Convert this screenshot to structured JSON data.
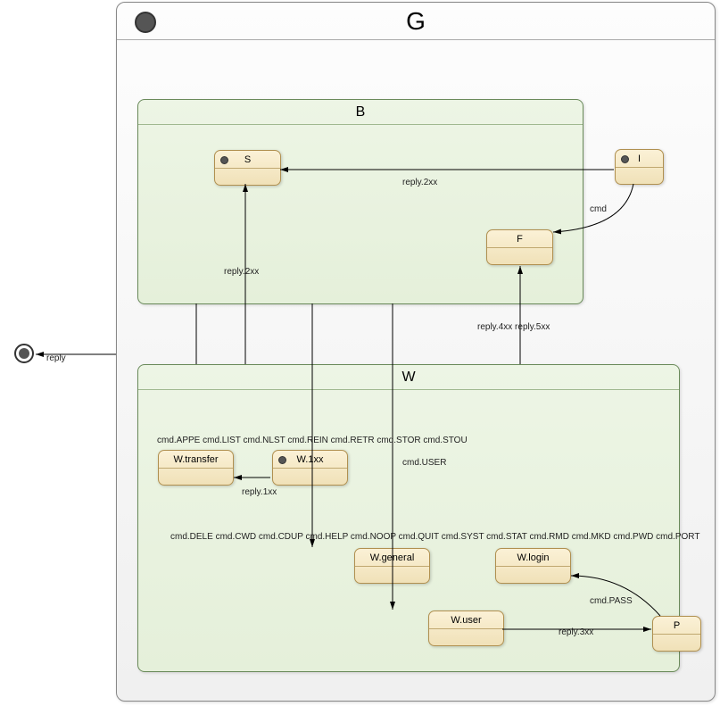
{
  "outer": {
    "title": "G"
  },
  "regions": {
    "B": {
      "title": "B"
    },
    "W": {
      "title": "W"
    }
  },
  "states": {
    "S": {
      "label": "S"
    },
    "I": {
      "label": "I"
    },
    "F": {
      "label": "F"
    },
    "Wtransfer": {
      "label": "W.transfer"
    },
    "W1xx": {
      "label": "W.1xx"
    },
    "Wgeneral": {
      "label": "W.general"
    },
    "Wlogin": {
      "label": "W.login"
    },
    "Wuser": {
      "label": "W.user"
    },
    "P": {
      "label": "P"
    }
  },
  "edges": {
    "reply": "reply",
    "reply2xx_IS": "reply.2xx",
    "cmd_IF": "cmd",
    "reply2xx_BS": "reply.2xx",
    "reply45xx": "reply.4xx reply.5xx",
    "cmdUSER": "cmd.USER",
    "transferCmds": "cmd.APPE cmd.LIST cmd.NLST cmd.REIN cmd.RETR cmd.STOR cmd.STOU",
    "reply1xx": "reply.1xx",
    "generalCmds": "cmd.DELE cmd.CWD cmd.CDUP cmd.HELP cmd.NOOP cmd.QUIT cmd.SYST cmd.STAT cmd.RMD cmd.MKD cmd.PWD cmd.PORT",
    "cmdPASS": "cmd.PASS",
    "reply3xx": "reply.3xx"
  }
}
